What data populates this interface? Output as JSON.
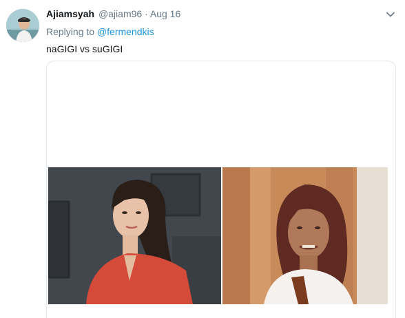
{
  "tweet": {
    "display_name": "Ajiamsyah",
    "handle": "@ajiam96",
    "separator": "·",
    "date": "Aug 16",
    "replying_prefix": "Replying to",
    "reply_to": "@fermendkis",
    "text": "naGIGI vs suGIGI"
  },
  "icons": {
    "caret": "chevron-down-icon"
  },
  "colors": {
    "link": "#1b95e0",
    "secondary_text": "#657786",
    "primary_text": "#14171a",
    "card_border": "#e1e8ed"
  }
}
